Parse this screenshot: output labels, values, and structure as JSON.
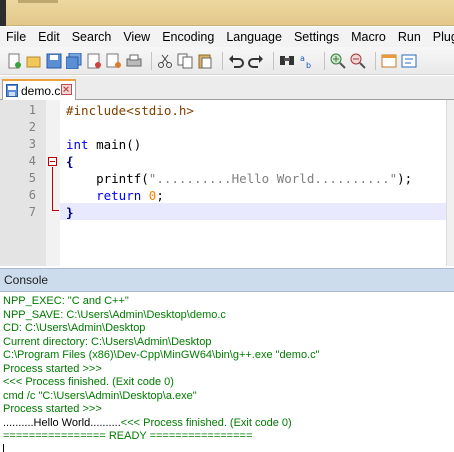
{
  "menu": [
    "File",
    "Edit",
    "Search",
    "View",
    "Encoding",
    "Language",
    "Settings",
    "Macro",
    "Run",
    "Plug"
  ],
  "toolbar_icons": [
    "new-file-icon",
    "open-file-icon",
    "save-icon",
    "save-all-icon",
    "close-icon",
    "close-all-icon",
    "print-icon",
    "sep",
    "cut-icon",
    "copy-icon",
    "paste-icon",
    "sep",
    "undo-icon",
    "redo-icon",
    "sep",
    "find-icon",
    "replace-icon",
    "sep",
    "zoom-in-icon",
    "zoom-out-icon",
    "sep",
    "sync-scroll-icon",
    "wrap-icon"
  ],
  "tab": {
    "label": "demo.c"
  },
  "editor": {
    "line_numbers": [
      "1",
      "2",
      "3",
      "4",
      "5",
      "6",
      "7"
    ],
    "lines": [
      {
        "parts": [
          {
            "cls": "c-pre",
            "text": "#include<stdio.h>"
          }
        ]
      },
      {
        "parts": []
      },
      {
        "parts": [
          {
            "cls": "c-kw",
            "text": "int"
          },
          {
            "cls": "c-plain",
            "text": " main()"
          }
        ]
      },
      {
        "parts": [
          {
            "cls": "c-op",
            "text": "{"
          }
        ]
      },
      {
        "parts": [
          {
            "cls": "c-plain",
            "text": "    printf("
          },
          {
            "cls": "c-str",
            "text": "\"..........Hello World..........\""
          },
          {
            "cls": "c-plain",
            "text": ");"
          }
        ]
      },
      {
        "parts": [
          {
            "cls": "c-kw",
            "text": "    return"
          },
          {
            "cls": "c-plain",
            "text": " "
          },
          {
            "cls": "c-num",
            "text": "0"
          },
          {
            "cls": "c-plain",
            "text": ";"
          }
        ]
      },
      {
        "parts": [
          {
            "cls": "c-op",
            "text": "}"
          }
        ]
      }
    ]
  },
  "console": {
    "title": "Console",
    "lines": [
      {
        "text": "NPP_EXEC: \"C and C++\"",
        "color": "green"
      },
      {
        "text": "NPP_SAVE: C:\\Users\\Admin\\Desktop\\demo.c",
        "color": "green"
      },
      {
        "text": "CD: C:\\Users\\Admin\\Desktop",
        "color": "green"
      },
      {
        "text": "Current directory: C:\\Users\\Admin\\Desktop",
        "color": "green"
      },
      {
        "text": "C:\\Program Files (x86)\\Dev-Cpp\\MinGW64\\bin\\g++.exe \"demo.c\"",
        "color": "green"
      },
      {
        "text": "Process started >>>",
        "color": "green"
      },
      {
        "text": "<<< Process finished. (Exit code 0)",
        "color": "green"
      },
      {
        "text": "cmd /c \"C:\\Users\\Admin\\Desktop\\a.exe\"",
        "color": "green"
      },
      {
        "text": "Process started >>>",
        "color": "green"
      },
      {
        "text": "..........Hello World..........",
        "color": "black",
        "suffix": "<<< Process finished. (Exit code 0)"
      },
      {
        "text": "================ READY ================",
        "color": "green"
      }
    ]
  }
}
